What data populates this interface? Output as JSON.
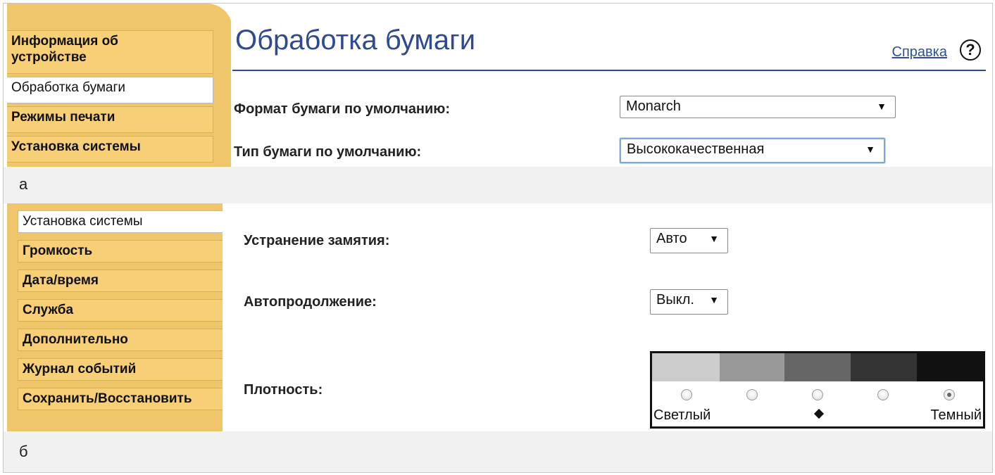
{
  "panel_a": {
    "nav": [
      {
        "label": "Информация об\nустройстве",
        "active": false
      },
      {
        "label": "Обработка бумаги",
        "active": true
      },
      {
        "label": "Режимы печати",
        "active": false
      },
      {
        "label": "Установка системы",
        "active": false
      }
    ],
    "title": "Обработка бумаги",
    "help_label": "Справка",
    "help_icon": "?",
    "fields": [
      {
        "label": "Формат бумаги по умолчанию:",
        "value": "Monarch"
      },
      {
        "label": "Тип бумаги по умолчанию:",
        "value": "Высококачественная"
      }
    ],
    "caption": "а"
  },
  "panel_b": {
    "nav": [
      {
        "label": "Установка системы",
        "active": true
      },
      {
        "label": "Громкость",
        "active": false
      },
      {
        "label": "Дата/время",
        "active": false
      },
      {
        "label": "Служба",
        "active": false
      },
      {
        "label": "Дополнительно",
        "active": false
      },
      {
        "label": "Журнал событий",
        "active": false
      },
      {
        "label": "Сохранить/Восстановить",
        "active": false
      }
    ],
    "fields": [
      {
        "label": "Устранение замятия:",
        "value": "Авто"
      },
      {
        "label": "Автопродолжение:",
        "value": "Выкл."
      }
    ],
    "density": {
      "label": "Плотность:",
      "light_label": "Светлый",
      "dark_label": "Темный",
      "selected_level": 5,
      "levels": 5,
      "swatch_colors": [
        "#cccccc",
        "#999999",
        "#666666",
        "#333333",
        "#111111"
      ]
    },
    "caption": "б"
  },
  "arrow_glyph": "▼"
}
